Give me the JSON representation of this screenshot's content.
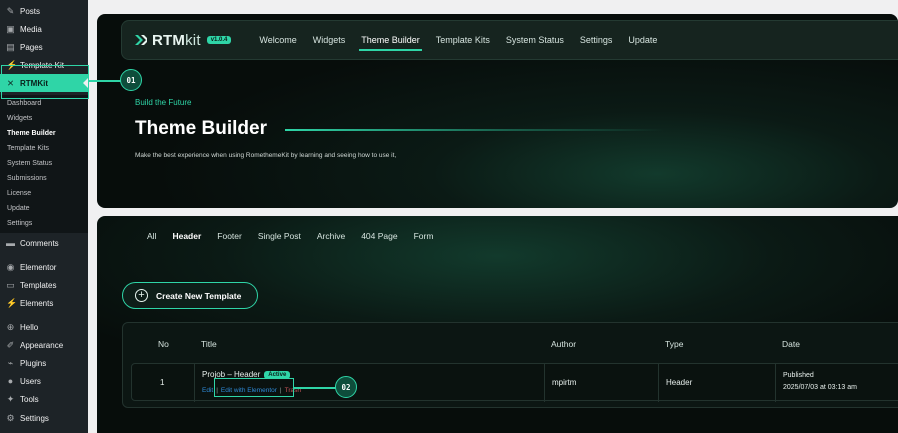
{
  "sidebar": {
    "items": [
      {
        "label": "Posts",
        "icon": "pin-icon"
      },
      {
        "label": "Media",
        "icon": "media-icon"
      },
      {
        "label": "Pages",
        "icon": "page-icon"
      },
      {
        "label": "Template Kit",
        "icon": "template-kit-icon"
      },
      {
        "label": "RTMKit",
        "icon": "rtmkit-icon"
      },
      {
        "label": "Comments",
        "icon": "comment-icon"
      },
      {
        "label": "Elementor",
        "icon": "elementor-icon"
      },
      {
        "label": "Templates",
        "icon": "folder-icon"
      },
      {
        "label": "Elements",
        "icon": "elements-icon"
      },
      {
        "label": "Hello",
        "icon": "hello-icon"
      },
      {
        "label": "Appearance",
        "icon": "brush-icon"
      },
      {
        "label": "Plugins",
        "icon": "plug-icon"
      },
      {
        "label": "Users",
        "icon": "user-icon"
      },
      {
        "label": "Tools",
        "icon": "wrench-icon"
      },
      {
        "label": "Settings",
        "icon": "settings-icon"
      }
    ],
    "submenu": [
      "Dashboard",
      "Widgets",
      "Theme Builder",
      "Template Kits",
      "System Status",
      "Submissions",
      "License",
      "Update",
      "Settings"
    ]
  },
  "header": {
    "logo": {
      "brand": "RTM",
      "suffix": "kit",
      "version": "v1.0.4"
    },
    "tabs": [
      "Welcome",
      "Widgets",
      "Theme Builder",
      "Template Kits",
      "System Status",
      "Settings",
      "Update"
    ],
    "active_tab": "Theme Builder"
  },
  "hero": {
    "eyebrow": "Build the Future",
    "title": "Theme Builder",
    "description": "Make the best experience when using RomethemeKit by learning and seeing how to use it,"
  },
  "filters": {
    "items": [
      "All",
      "Header",
      "Footer",
      "Single Post",
      "Archive",
      "404 Page",
      "Form"
    ],
    "active": "Header"
  },
  "create_button": {
    "label": "Create New Template"
  },
  "table": {
    "columns": [
      "No",
      "Title",
      "Author",
      "Type",
      "Date"
    ],
    "rows": [
      {
        "no": "1",
        "title": "Projob – Header",
        "badge": "Active",
        "actions": [
          "Edit",
          "Edit with Elementor",
          "Trash"
        ],
        "author": "mpirtm",
        "type": "Header",
        "status": "Published",
        "date": "2025/07/03 at 03:13 am"
      }
    ]
  },
  "callouts": [
    "01",
    "02"
  ],
  "colors": {
    "accent": "#2fd5a7",
    "sidebar": "#1d2327",
    "panel": "#0b1a15",
    "link": "#2f8bd8"
  }
}
